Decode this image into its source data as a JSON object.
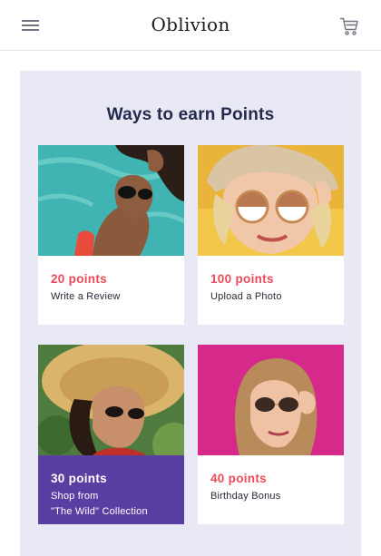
{
  "header": {
    "brand": "Oblivion",
    "icons": {
      "menu": "hamburger-menu-icon",
      "cart": "shopping-cart-icon"
    }
  },
  "rewards": {
    "title": "Ways to earn Points",
    "cards": [
      {
        "points": "20 points",
        "description": "Write a Review",
        "image": "woman-sunglasses-pool-photo",
        "selected": false
      },
      {
        "points": "100 points",
        "description": "Upload a Photo",
        "image": "woman-beige-hat-white-sunglasses-photo",
        "selected": false
      },
      {
        "points": "30 points",
        "description": "Shop from\n\"The Wild\" Collection",
        "image": "woman-straw-hat-sunglasses-photo",
        "selected": true
      },
      {
        "points": "40 points",
        "description": "Birthday Bonus",
        "image": "woman-pink-background-sunglasses-photo",
        "selected": false
      }
    ]
  },
  "colors": {
    "panel_bg": "#e9e9f5",
    "accent_points": "#ef4a5a",
    "selected_card": "#5a3fa3",
    "title": "#232a4e"
  }
}
